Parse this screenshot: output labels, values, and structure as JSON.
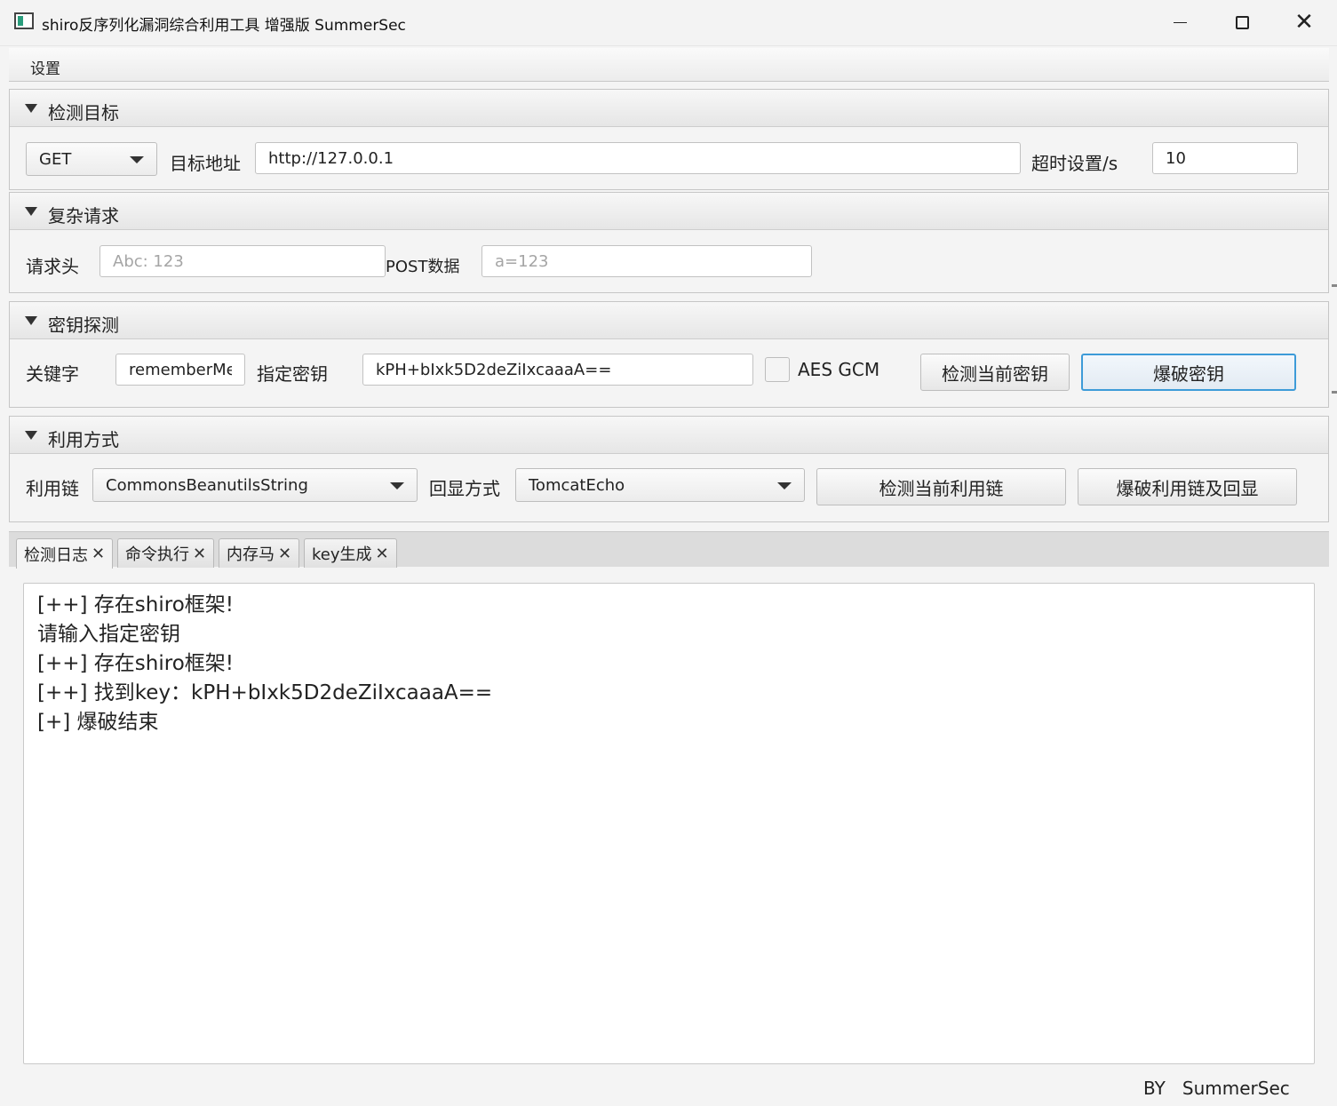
{
  "window": {
    "title": "shiro反序列化漏洞综合利用工具 增强版 SummerSec",
    "minimize": "",
    "close": "✕"
  },
  "menu": {
    "settings": "设置"
  },
  "target": {
    "title": "检测目标",
    "method": "GET",
    "url_label": "目标地址",
    "url_value": "http://127.0.0.1",
    "timeout_label": "超时设置/s",
    "timeout_value": "10"
  },
  "complex": {
    "title": "复杂请求",
    "header_label": "请求头",
    "header_placeholder": "Abc: 123",
    "post_label": "POST数据",
    "post_placeholder": "a=123"
  },
  "key": {
    "title": "密钥探测",
    "keyword_label": "关键字",
    "keyword_value": "rememberMe",
    "key_label": "指定密钥",
    "key_value": "kPH+bIxk5D2deZiIxcaaaA==",
    "aes_gcm_label": "AES GCM",
    "detect_button": "检测当前密钥",
    "brute_button": "爆破密钥"
  },
  "exploit": {
    "title": "利用方式",
    "chain_label": "利用链",
    "chain_value": "CommonsBeanutilsString",
    "echo_label": "回显方式",
    "echo_value": "TomcatEcho",
    "detect_chain_button": "检测当前利用链",
    "brute_chain_button": "爆破利用链及回显"
  },
  "tabs": [
    {
      "label": "检测日志",
      "close": "✕"
    },
    {
      "label": "命令执行",
      "close": "✕"
    },
    {
      "label": "内存马",
      "close": "✕"
    },
    {
      "label": "key生成",
      "close": "✕"
    }
  ],
  "log": [
    "[++] 存在shiro框架!",
    "请输入指定密钥",
    "[++] 存在shiro框架!",
    "[++] 找到key：kPH+bIxk5D2deZiIxcaaaA==",
    "[+] 爆破结束"
  ],
  "footer": "BY   SummerSec"
}
